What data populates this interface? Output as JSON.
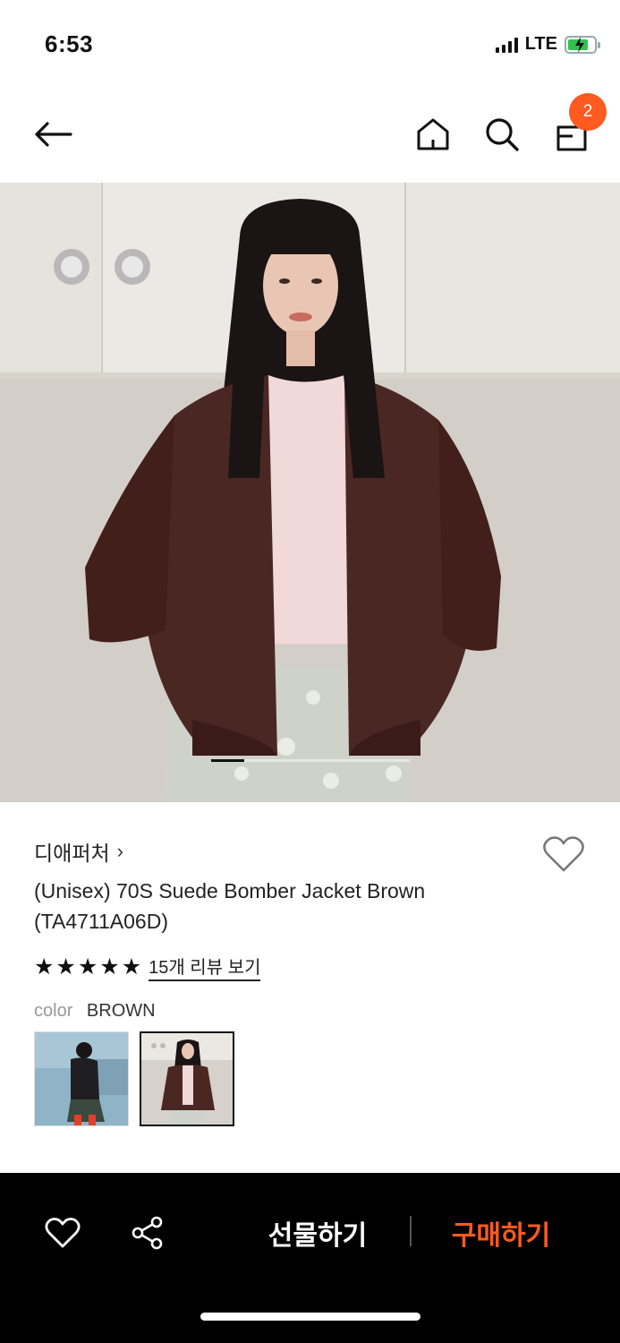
{
  "status_bar": {
    "time": "6:53",
    "network": "LTE",
    "icons": [
      "signal-icon",
      "battery-charging-icon"
    ]
  },
  "nav": {
    "icons": [
      "back-arrow-icon",
      "home-icon",
      "search-icon",
      "shopping-bag-icon"
    ],
    "cart_count": "2"
  },
  "product": {
    "brand": "디애퍼처",
    "brand_chevron": "›",
    "title": "(Unisex) 70S Suede Bomber Jacket Brown (TA4711A06D)",
    "rating_stars": 5,
    "star_glyph": "★",
    "review_link": "15개 리뷰 보기",
    "color_label": "color",
    "color_value": "BROWN",
    "thumbnails": [
      {
        "name": "thumbnail-1",
        "selected": false
      },
      {
        "name": "thumbnail-2",
        "selected": true
      }
    ],
    "gallery": {
      "current_index": 1,
      "total": 6
    }
  },
  "bottom_bar": {
    "gift_label": "선물하기",
    "buy_label": "구매하기",
    "icons": [
      "heart-icon",
      "share-icon"
    ]
  },
  "colors": {
    "accent": "#ff5a1f",
    "bottom_bar_bg": "#000000",
    "text_primary": "#222222",
    "text_muted": "#999999"
  }
}
